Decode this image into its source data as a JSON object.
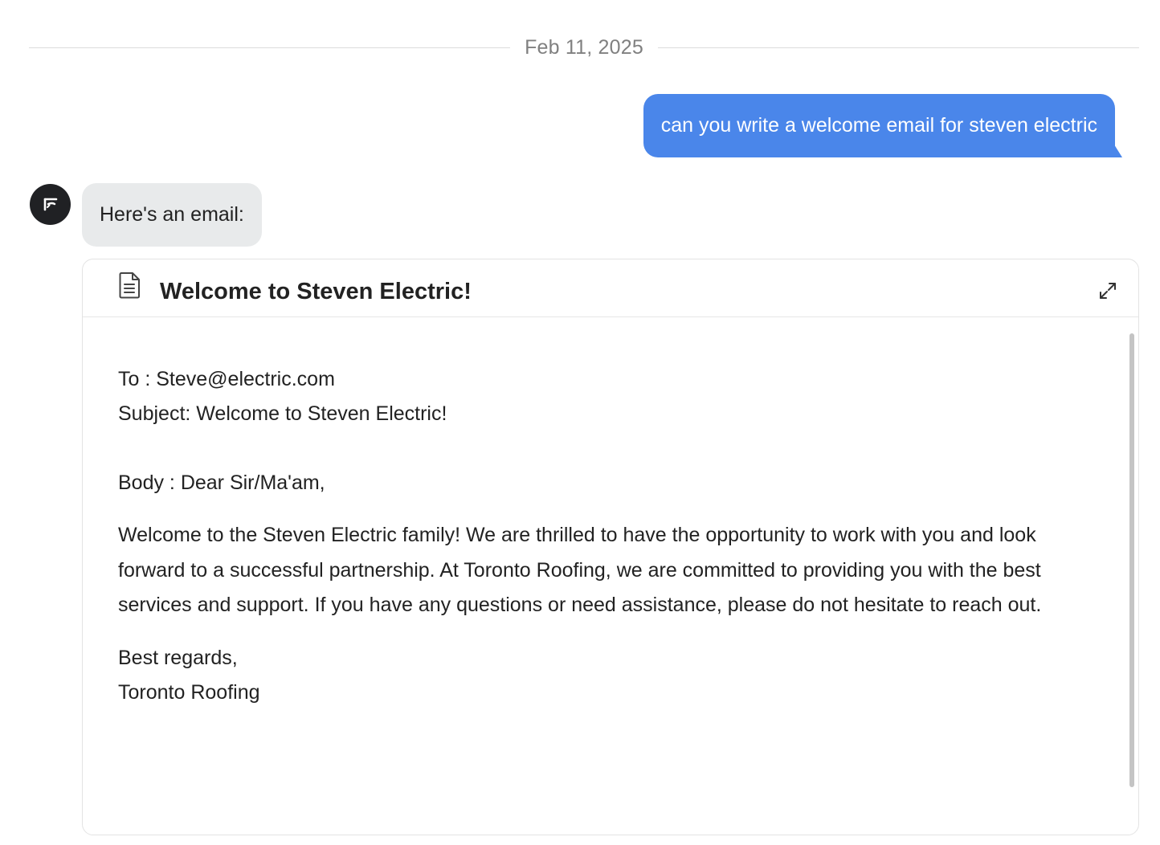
{
  "date_divider": {
    "text": "Feb 11, 2025"
  },
  "user_message": {
    "text": "can you write a welcome email for steven electric"
  },
  "bot_message": {
    "text": "Here's an email:",
    "avatar_icon": "assistant-logo-icon"
  },
  "email_card": {
    "icon": "document-icon",
    "title": "Welcome to Steven Electric!",
    "expand_icon": "expand-icon",
    "to_line": "To : Steve@electric.com",
    "subject_line": "Subject: Welcome to Steven Electric!",
    "body_greeting": "Body : Dear Sir/Ma'am,",
    "body_paragraph": "Welcome to the Steven Electric family! We are thrilled to have the opportunity to work with you and look forward to a successful partnership. At Toronto Roofing, we are committed to providing you with the best services and support. If you have any questions or need assistance, please do not hesitate to reach out.",
    "closing": "Best regards,",
    "signature": "Toronto Roofing"
  },
  "colors": {
    "user_bubble": "#4a86ea",
    "bot_bubble": "#e8eaeb",
    "avatar_bg": "#202124",
    "date_text": "#808080"
  }
}
